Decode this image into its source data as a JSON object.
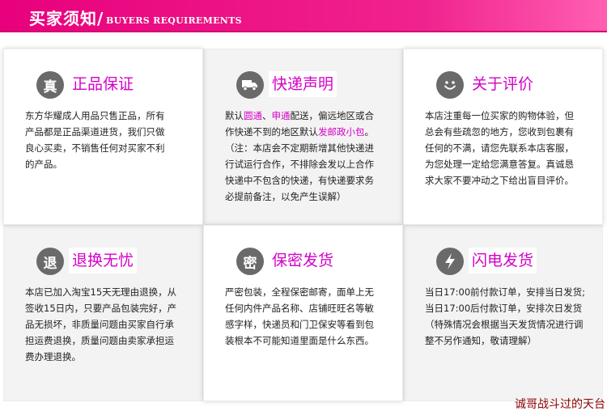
{
  "header": {
    "title": "买家须知/",
    "subtitle": "BUYERS REQUIREMENTS"
  },
  "cards": [
    {
      "icon": "真",
      "title": "正品保证",
      "lines": [
        "东方华耀成人用品只售正品，所有",
        "产品都是正品渠道进货，我们只做",
        "良心买卖，不销售任何对买家不利",
        "的产品。"
      ]
    },
    {
      "icon": "truck-icon",
      "title": "快递声明",
      "line1_a": "默认",
      "line1_hl1": "圆通",
      "line1_b": "、",
      "line1_hl2": "申通",
      "line1_c": "配送，偏远地区或合",
      "line2_a": "作快递不到的地区默认",
      "line2_hl": "发邮政小包",
      "line2_b": "。",
      "lines": [
        "（注：本店会不定期新增其他快递进",
        "行试运行合作，不排除会发以上合作",
        "快递中不包含的快递，有快递要求务",
        "必提前备注，以免产生误解）"
      ]
    },
    {
      "icon": "smiley-icon",
      "title": "关于评价",
      "lines": [
        "本店注重每一位买家的购物体验，但",
        "总会有些疏忽的地方，您收到包裹有",
        "任何的不满，请您先联系本店客服，",
        "为您处理一定给您满意答复。真诚恳",
        "求大家不要冲动之下给出盲目评价。"
      ]
    },
    {
      "icon": "退",
      "title": "退换无忧",
      "lines": [
        "本店已加入淘宝15天无理由退换，从",
        "签收15日内，只要产品包装完好，产",
        "品无损坏，非质量问题由买家自行承",
        "担运费退换，质量问题由卖家承担运",
        "费办理退换。"
      ]
    },
    {
      "icon": "密",
      "title": "保密发货",
      "lines": [
        "严密包装，全程保密邮寄，面单上无",
        "任何内件产品名称、店铺旺旺名等敏",
        "感字样，快递员和门卫保安等看到包",
        "装根本不可能知道里面是什么东西。"
      ]
    },
    {
      "icon": "lightning-icon",
      "title": "闪电发货",
      "lines": [
        "当日17:00前付款订单，安排当日发货;",
        "当日17:00后付款订单，安排次日发货",
        "（特殊情况会根据当天发货情况进行调",
        "整不另作通知，敬请理解）"
      ]
    }
  ],
  "footer": {
    "text": "诚哥战斗过的天台"
  }
}
